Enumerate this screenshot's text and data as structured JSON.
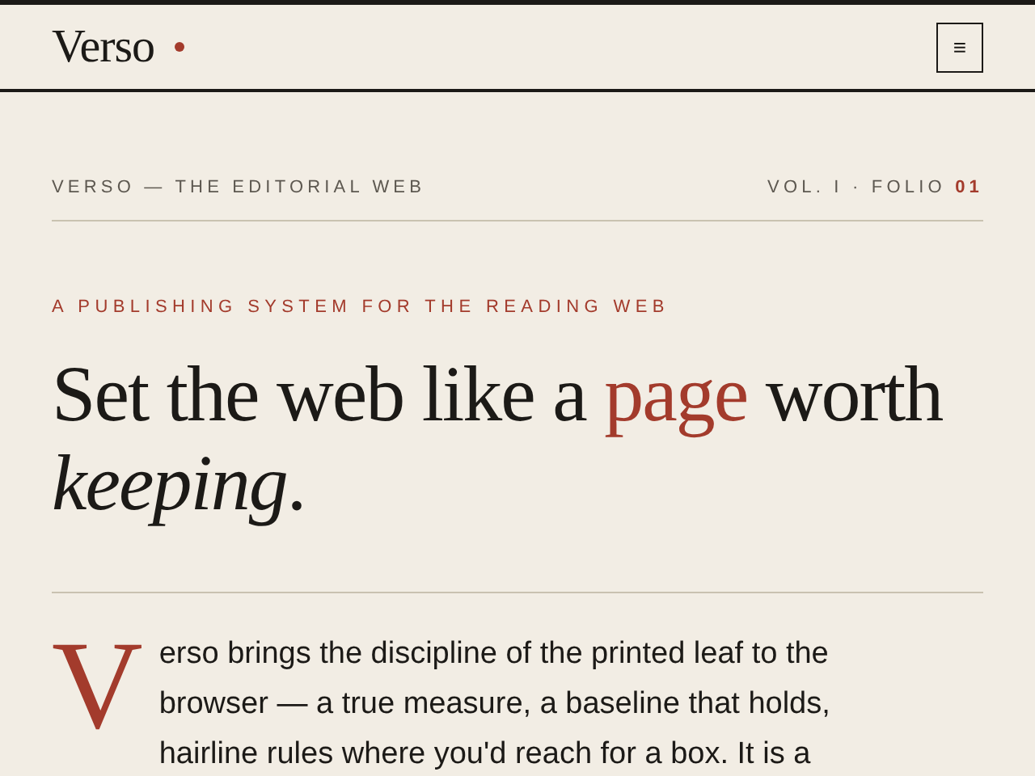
{
  "header": {
    "logo": "Verso",
    "menu_button": "≡"
  },
  "meta": {
    "left": "VERSO — THE EDITORIAL WEB",
    "right": "VOL. I · FOLIO **01**"
  },
  "eyebrow": "A PUBLISHING SYSTEM FOR THE READING WEB",
  "headline": "Set the web like a **page** worth *keeping*.",
  "intro": {
    "drop_cap": "V",
    "text": "erso brings the discipline of the printed leaf to the browser — a true measure, a baseline that holds, hairline rules where you'd reach for a box. It is a"
  }
}
